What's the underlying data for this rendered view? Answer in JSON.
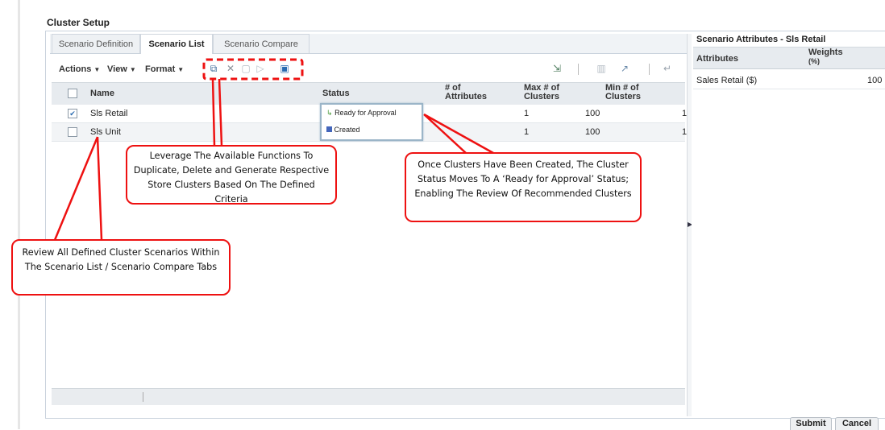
{
  "window": {
    "title": "Cluster Setup"
  },
  "tabs": [
    {
      "label": "Scenario Definition",
      "active": false
    },
    {
      "label": "Scenario List",
      "active": true
    },
    {
      "label": "Scenario Compare",
      "active": false
    }
  ],
  "toolbar": {
    "menus": [
      "Actions",
      "View",
      "Format"
    ],
    "icons": [
      "duplicate-icon",
      "delete-icon",
      "save-icon",
      "run-icon",
      "generate-clusters-icon",
      "export-icon",
      "freeze-icon",
      "detach-icon",
      "wrap-icon"
    ]
  },
  "grid": {
    "columns": [
      "Name",
      "Status",
      "# of Attributes",
      "Max # of Clusters",
      "Min # of Clusters"
    ],
    "column_lines": {
      "attributes": [
        "# of",
        "Attributes"
      ],
      "max": [
        "Max # of",
        "Clusters"
      ],
      "min": [
        "Min # of",
        "Clusters"
      ]
    },
    "rows": [
      {
        "checked": true,
        "name": "Sls Retail",
        "status": "Ready for Approval",
        "status_icon": "ready-icon",
        "attributes": "1",
        "max": "100",
        "min": "1"
      },
      {
        "checked": false,
        "name": "Sls Unit",
        "status": "Created",
        "status_icon": "created-icon",
        "attributes": "1",
        "max": "100",
        "min": "1"
      }
    ]
  },
  "right_panel": {
    "title": "Scenario Attributes - Sls Retail",
    "columns": [
      "Attributes",
      "Weights (%)"
    ],
    "weights_lines": [
      "Weights",
      "(%)"
    ],
    "rows": [
      {
        "attribute": "Sales Retail ($)",
        "weight": "100"
      }
    ]
  },
  "buttons": {
    "submit": "Submit",
    "cancel": "Cancel"
  },
  "annotations": {
    "functions": "Leverage The Available Functions To Duplicate, Delete and Generate Respective Store Clusters Based On The Defined Criteria",
    "status": "Once Clusters Have Been Created, The Cluster Status Moves To A ‘Ready for Approval’ Status; Enabling The Review Of Recommended Clusters",
    "review": "Review All Defined Cluster Scenarios Within The Scenario List / Scenario Compare Tabs"
  },
  "colors": {
    "callout": "#e11111",
    "ready_icon": "#4a9a3a",
    "created_icon": "#4466bb",
    "header_bg": "#e7ebef"
  }
}
